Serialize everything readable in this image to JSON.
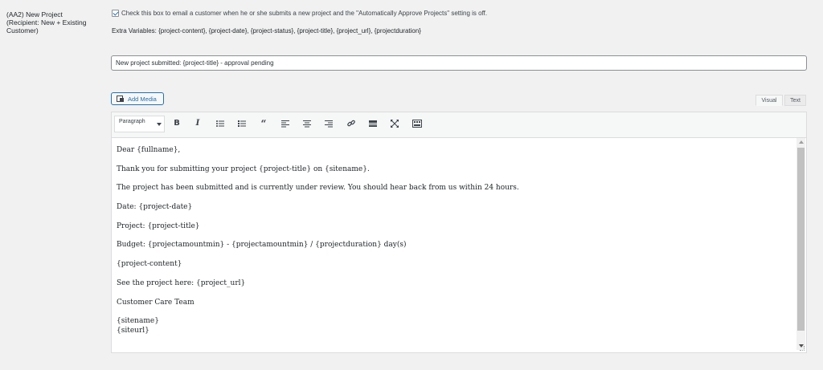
{
  "setting": {
    "label_line1": "(AA2) New Project",
    "label_line2": "(Recipient: New + Existing",
    "label_line3": "Customer)"
  },
  "checkbox": {
    "checked": true,
    "label": "Check this box to email a customer when he or she submits a new project and the \"Automatically Approve Projects\" setting is off."
  },
  "extra_variables": "Extra Variables: {project-content}, {project-date}, {project-status}, {project-title}, {project_url}, {projectduration}",
  "subject": {
    "value": "New project submitted: {project-title} - approval pending"
  },
  "editor": {
    "add_media_label": "Add Media",
    "tabs": {
      "visual": "Visual",
      "text": "Text"
    },
    "format_select": "Paragraph",
    "toolbar_icons": [
      "bold-icon",
      "italic-icon",
      "bullet-list-icon",
      "numbered-list-icon",
      "blockquote-icon",
      "align-left-icon",
      "align-center-icon",
      "align-right-icon",
      "link-icon",
      "read-more-icon",
      "fullscreen-icon",
      "toolbar-toggle-icon"
    ],
    "body": [
      "Dear {fullname},",
      "Thank you for submitting your project {project-title} on {sitename}.",
      "The project has been submitted and is currently under review. You should hear back from us within 24 hours.",
      "Date: {project-date}",
      "Project: {project-title}",
      "Budget: {projectamountmin} - {projectamountmin} / {projectduration} day(s)",
      "{project-content}",
      "See the project here: {project_url}",
      "Customer Care Team",
      "{sitename}",
      "{siteurl}"
    ]
  },
  "colors": {
    "accent": "#2271b1",
    "page_bg": "#f1f1f1",
    "scroll_thumb": "#c1c1c1"
  }
}
